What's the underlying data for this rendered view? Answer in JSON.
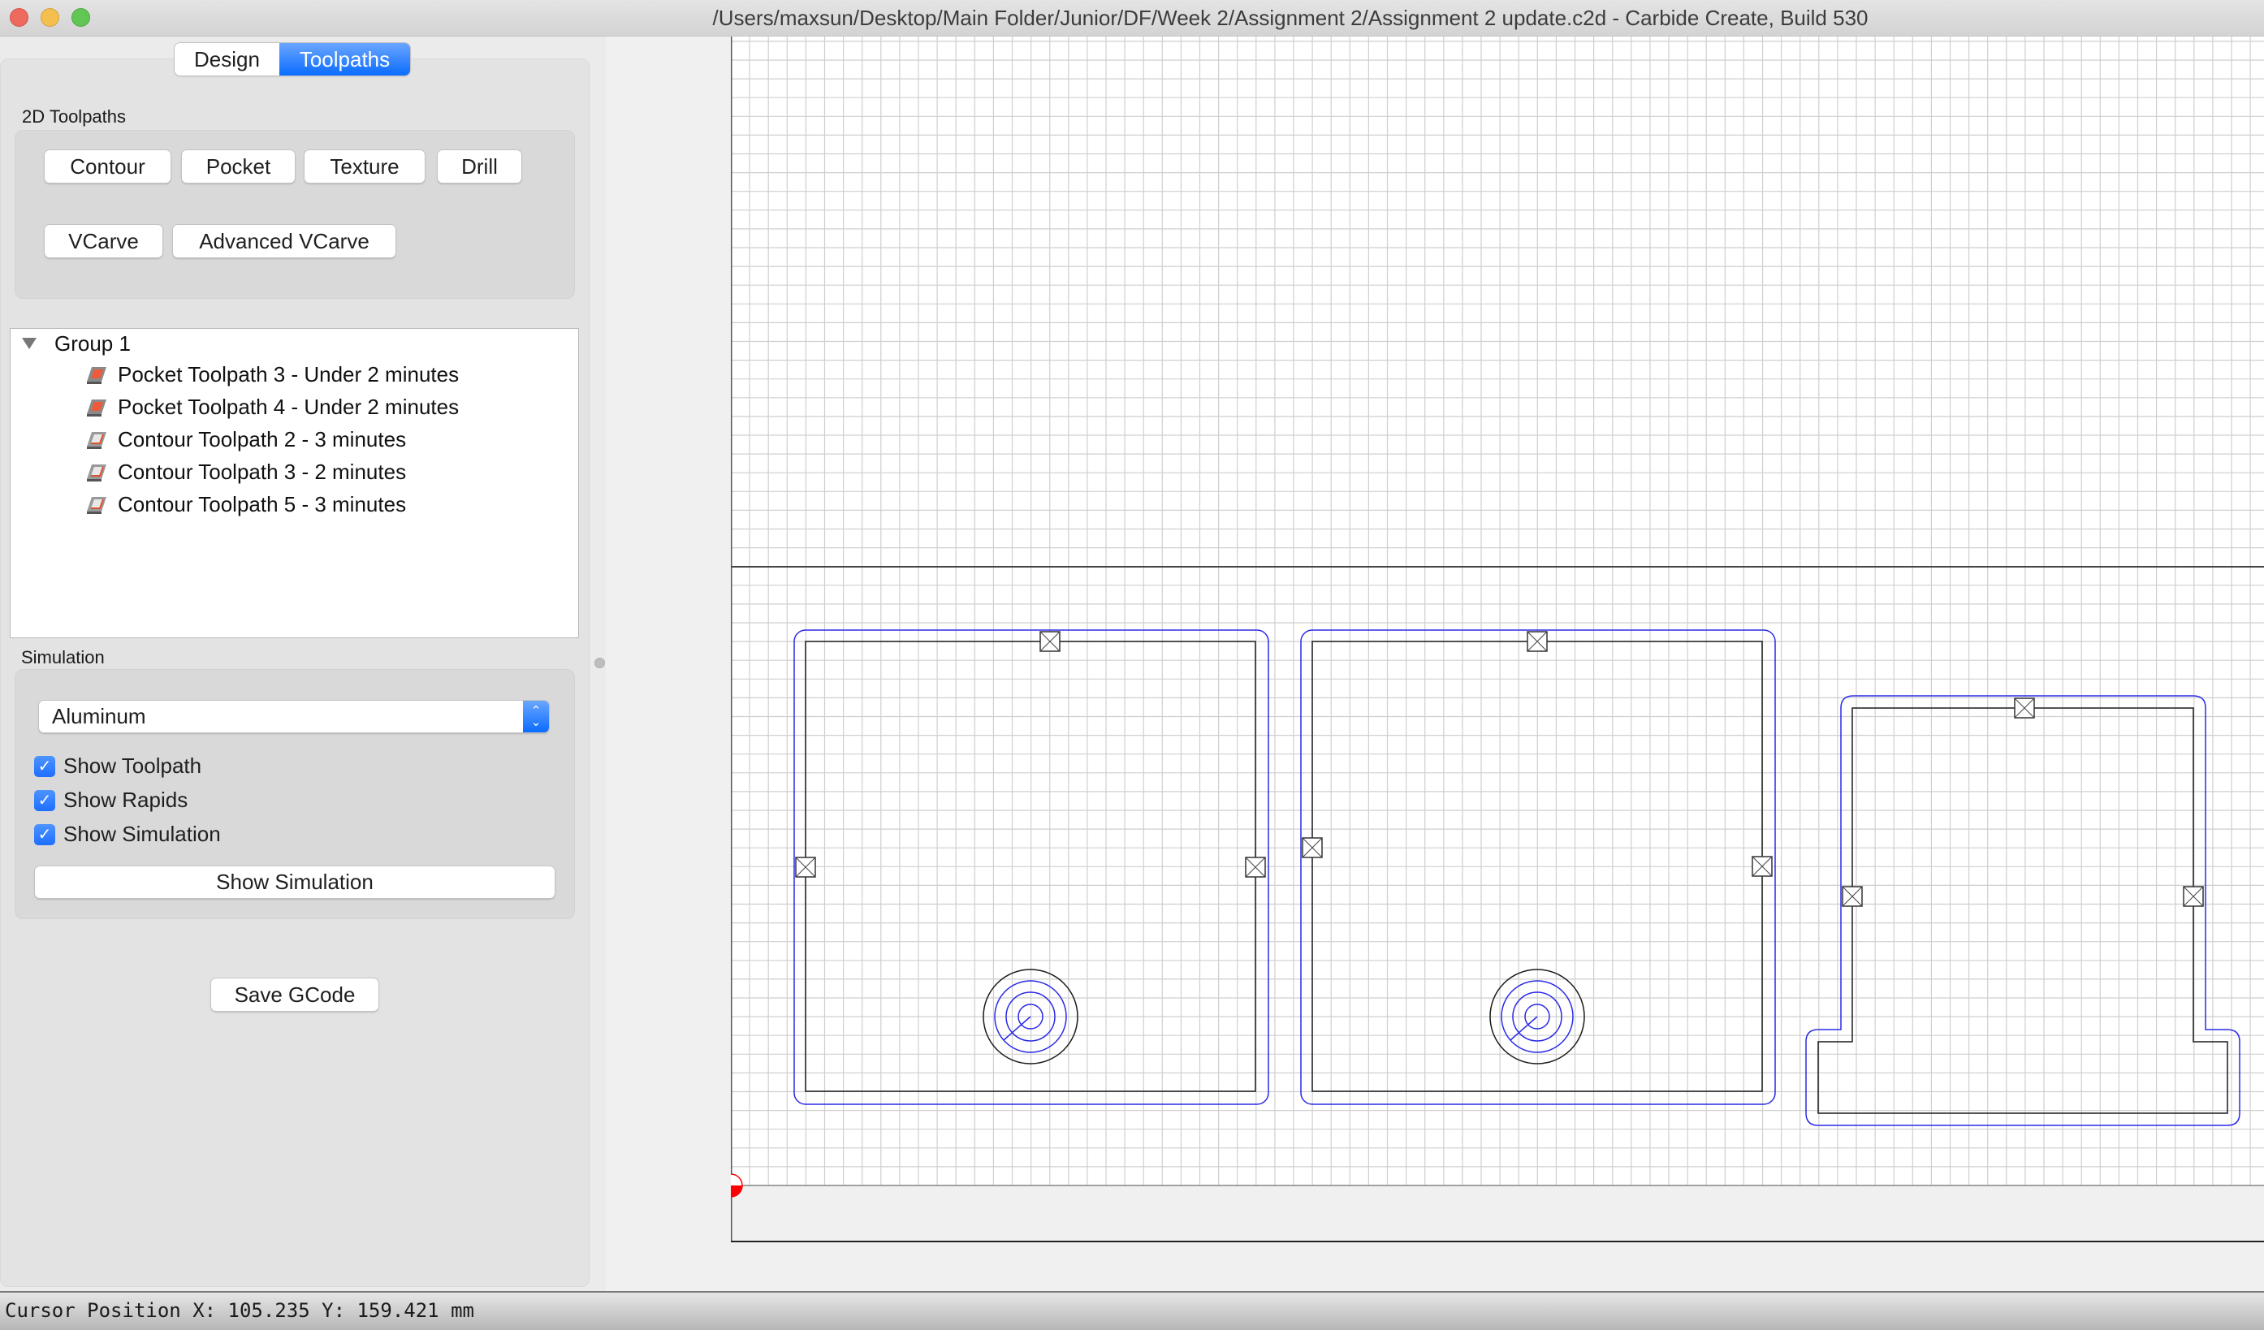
{
  "window": {
    "title": "/Users/maxsun/Desktop/Main Folder/Junior/DF/Week 2/Assignment 2/Assignment 2 update.c2d - Carbide Create, Build 530",
    "controls": [
      "close",
      "minimize",
      "zoom"
    ]
  },
  "mode_tabs": [
    {
      "label": "Design",
      "active": false
    },
    {
      "label": "Toolpaths",
      "active": true
    }
  ],
  "toolpaths_2d": {
    "label": "2D Toolpaths",
    "buttons": [
      "Contour",
      "Pocket",
      "Texture",
      "Drill",
      "VCarve",
      "Advanced VCarve"
    ]
  },
  "toolpath_tree": {
    "group": {
      "label": "Group 1",
      "expanded": true
    },
    "items": [
      {
        "label": "Pocket Toolpath 3 - Under 2 minutes",
        "icon": "pocket-toolpath-icon"
      },
      {
        "label": "Pocket Toolpath 4 - Under 2 minutes",
        "icon": "pocket-toolpath-icon"
      },
      {
        "label": "Contour Toolpath 2 - 3 minutes",
        "icon": "contour-toolpath-icon"
      },
      {
        "label": "Contour Toolpath 3 - 2 minutes",
        "icon": "contour-toolpath-icon"
      },
      {
        "label": "Contour Toolpath 5 - 3 minutes",
        "icon": "contour-toolpath-icon"
      }
    ]
  },
  "simulation": {
    "label": "Simulation",
    "material": "Aluminum",
    "checkboxes": [
      {
        "label": "Show Toolpath",
        "checked": true
      },
      {
        "label": "Show Rapids",
        "checked": true
      },
      {
        "label": "Show Simulation",
        "checked": true
      }
    ],
    "show_simulation_button": "Show Simulation"
  },
  "save_gcode_button": "Save GCode",
  "status": {
    "cursor_position": "Cursor Position X: 105.235 Y: 159.421 mm"
  },
  "canvas": {
    "parts": [
      {
        "name": "part-1",
        "tabs": 3,
        "has_hole": true
      },
      {
        "name": "part-2",
        "tabs": 3,
        "has_hole": true
      },
      {
        "name": "part-3",
        "tabs": 3,
        "has_hole": false
      }
    ],
    "colors": {
      "geometry": "#1a1a1a",
      "toolpath": "#2a2ae6",
      "grid": "#cfcfcf",
      "origin": "#ff0000",
      "accent": "#0a6cff"
    }
  }
}
